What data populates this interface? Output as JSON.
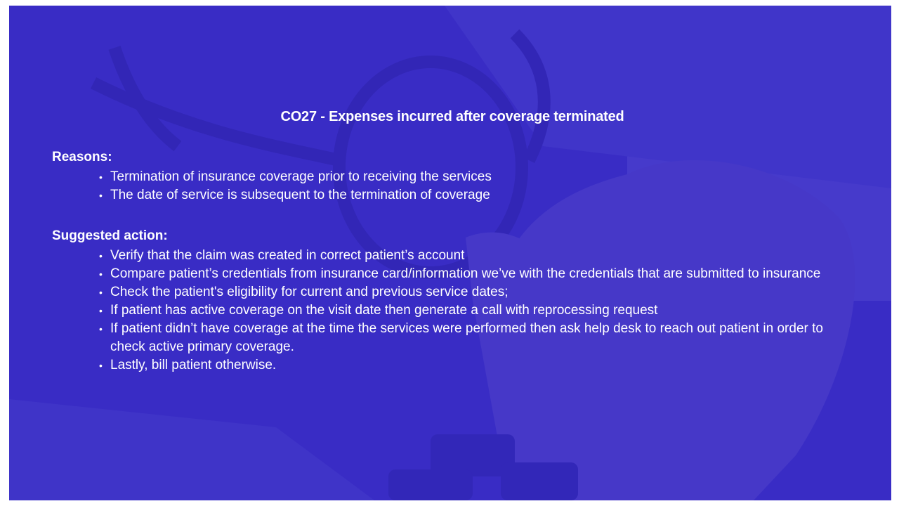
{
  "slide": {
    "title": "CO27 - Expenses incurred after coverage terminated",
    "reasons": {
      "heading": "Reasons:",
      "items": [
        "Termination of insurance coverage prior to receiving the services",
        "The date of service is subsequent to the termination of coverage"
      ]
    },
    "suggested_action": {
      "heading": "Suggested action:",
      "items": [
        "Verify that the claim was created in correct patient’s account",
        "Compare patient’s credentials from insurance card/information we’ve with the credentials that are submitted to insurance",
        "Check the patient's eligibility for current and previous service dates;",
        "If patient has active coverage on the visit date then generate a call with reprocessing request",
        "If patient didn’t have coverage at the time the services were performed then ask help desk to reach out patient in order to check active primary coverage.",
        "Lastly, bill patient otherwise."
      ]
    },
    "bullet_glyph": "•"
  },
  "colors": {
    "overlay": "#3428c8",
    "text": "#ffffff"
  }
}
